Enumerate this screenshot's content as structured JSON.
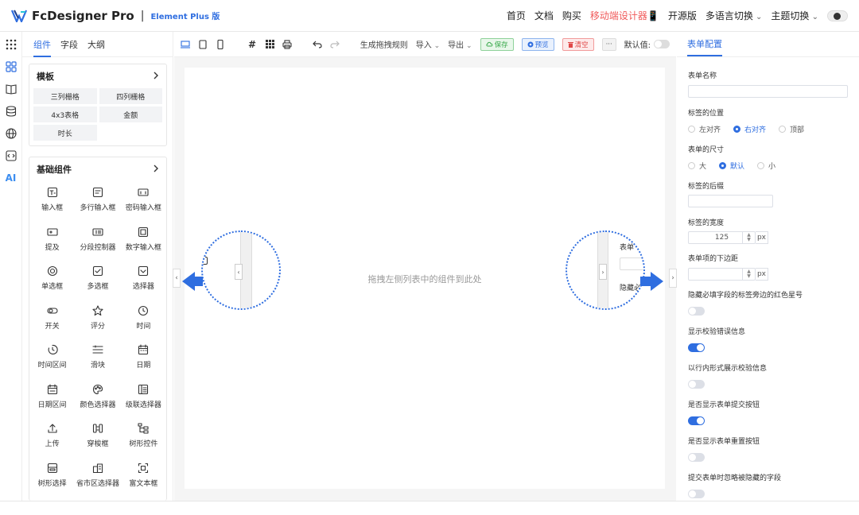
{
  "header": {
    "brand": "FcDesigner Pro",
    "separator": "|",
    "edition": "Element Plus 版",
    "nav": [
      {
        "label": "首页",
        "highlight": false,
        "dropdown": false
      },
      {
        "label": "文档",
        "highlight": false,
        "dropdown": false
      },
      {
        "label": "购买",
        "highlight": false,
        "dropdown": false
      },
      {
        "label": "移动端设计器📱",
        "highlight": true,
        "dropdown": false
      },
      {
        "label": "开源版",
        "highlight": false,
        "dropdown": false
      },
      {
        "label": "多语言切换",
        "highlight": false,
        "dropdown": true
      },
      {
        "label": "主题切换",
        "highlight": false,
        "dropdown": true
      }
    ]
  },
  "rail": {
    "icons": [
      "apps-grid-icon",
      "components-icon",
      "book-icon",
      "database-icon",
      "globe-icon",
      "code-icon"
    ],
    "ai_label": "AI"
  },
  "left_panel": {
    "tabs": [
      {
        "label": "组件",
        "active": true
      },
      {
        "label": "字段",
        "active": false
      },
      {
        "label": "大纲",
        "active": false
      }
    ],
    "templates": {
      "title": "模板",
      "items": [
        "三列栅格",
        "四列栅格",
        "4x3表格",
        "金额",
        "时长"
      ]
    },
    "basic": {
      "title": "基础组件",
      "items": [
        {
          "label": "输入框",
          "icon": "text-input-icon"
        },
        {
          "label": "多行输入框",
          "icon": "textarea-icon"
        },
        {
          "label": "密码输入框",
          "icon": "password-icon"
        },
        {
          "label": "提及",
          "icon": "mention-icon"
        },
        {
          "label": "分段控制器",
          "icon": "segmented-icon"
        },
        {
          "label": "数字输入框",
          "icon": "number-input-icon"
        },
        {
          "label": "单选框",
          "icon": "radio-icon"
        },
        {
          "label": "多选框",
          "icon": "checkbox-icon"
        },
        {
          "label": "选择器",
          "icon": "select-icon"
        },
        {
          "label": "开关",
          "icon": "switch-icon"
        },
        {
          "label": "评分",
          "icon": "star-icon"
        },
        {
          "label": "时间",
          "icon": "clock-icon"
        },
        {
          "label": "时间区间",
          "icon": "time-range-icon"
        },
        {
          "label": "滑块",
          "icon": "slider-icon"
        },
        {
          "label": "日期",
          "icon": "calendar-icon"
        },
        {
          "label": "日期区间",
          "icon": "date-range-icon"
        },
        {
          "label": "颜色选择器",
          "icon": "palette-icon"
        },
        {
          "label": "级联选择器",
          "icon": "cascader-icon"
        },
        {
          "label": "上传",
          "icon": "upload-icon"
        },
        {
          "label": "穿梭框",
          "icon": "transfer-icon"
        },
        {
          "label": "树形控件",
          "icon": "tree-icon"
        },
        {
          "label": "树形选择",
          "icon": "tree-select-icon"
        },
        {
          "label": "省市区选择器",
          "icon": "region-icon"
        },
        {
          "label": "富文本框",
          "icon": "rich-text-icon"
        }
      ]
    }
  },
  "toolbar": {
    "generate_rules": "生成拖拽规则",
    "import": "导入",
    "export": "导出",
    "save": "保存",
    "preview": "预览",
    "clear": "清空",
    "more": "···",
    "default_value": "默认值:"
  },
  "canvas": {
    "hint": "拖拽左侧列表中的组件到此处",
    "zoom_right_texts": [
      "表单",
      "隐藏必"
    ]
  },
  "right_panel": {
    "tab": "表单配置",
    "form_name_label": "表单名称",
    "form_name_value": "",
    "label_position": {
      "label": "标签的位置",
      "options": [
        {
          "label": "左对齐",
          "checked": false
        },
        {
          "label": "右对齐",
          "checked": true
        },
        {
          "label": "顶部",
          "checked": false
        }
      ]
    },
    "form_size": {
      "label": "表单的尺寸",
      "options": [
        {
          "label": "大",
          "checked": false
        },
        {
          "label": "默认",
          "checked": true
        },
        {
          "label": "小",
          "checked": false
        }
      ]
    },
    "label_suffix": "标签的后缀",
    "label_width": {
      "label": "标签的宽度",
      "value": "125",
      "unit": "px"
    },
    "item_margin": {
      "label": "表单项的下边距",
      "value": "",
      "unit": "px"
    },
    "toggles": [
      {
        "label": "隐藏必填字段的标签旁边的红色星号",
        "on": false
      },
      {
        "label": "显示校验错误信息",
        "on": true
      },
      {
        "label": "以行内形式展示校验信息",
        "on": false
      },
      {
        "label": "是否显示表单提交按钮",
        "on": true
      },
      {
        "label": "是否显示表单重置按钮",
        "on": false
      },
      {
        "label": "提交表单时忽略被隐藏的字段",
        "on": false
      }
    ]
  },
  "colors": {
    "accent": "#2f6ee0",
    "highlight_nav": "#f05a5a",
    "save": "#3aa94c",
    "clear": "#e04848"
  }
}
